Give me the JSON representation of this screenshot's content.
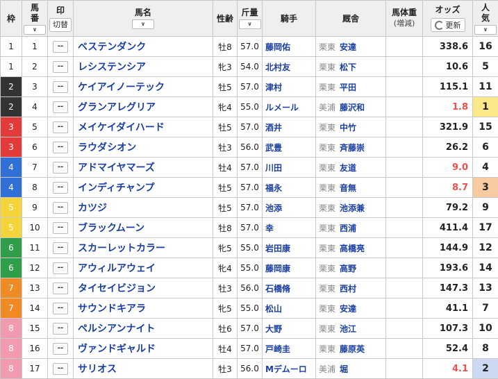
{
  "colors": {
    "waku": {
      "1": {
        "bg": "#ffffff",
        "fg": "#222222"
      },
      "2": {
        "bg": "#333333",
        "fg": "#ffffff"
      },
      "3": {
        "bg": "#e33a3a",
        "fg": "#ffffff"
      },
      "4": {
        "bg": "#2f6fd6",
        "fg": "#ffffff"
      },
      "5": {
        "bg": "#f5d43a",
        "fg": "#ffffff"
      },
      "6": {
        "bg": "#2e9e48",
        "fg": "#ffffff"
      },
      "7": {
        "bg": "#f08a24",
        "fg": "#ffffff"
      },
      "8": {
        "bg": "#f29ab0",
        "fg": "#ffffff"
      }
    },
    "odds_hot": "#e8524f",
    "odds_normal": "#222222",
    "pop": {
      "1": "#fbe98a",
      "2": "#cdd8f2",
      "3": "#f6cba2"
    }
  },
  "header": {
    "waku": "枠",
    "umaban": [
      "馬",
      "番"
    ],
    "mark": "印",
    "mark_switch": "切替",
    "name": "馬名",
    "sexage": "性齢",
    "weight": "斤量",
    "jockey": "騎手",
    "stable": "厩舎",
    "bodyweight": "馬体重",
    "bodyweight_sub": "(増減)",
    "odds": "オッズ",
    "refresh": "更新",
    "pop": [
      "人",
      "気"
    ],
    "sort_icon": "chevron-down-icon"
  },
  "mark_placeholder": "--",
  "rows": [
    {
      "waku": "1",
      "uma": "1",
      "name": "ベステンダンク",
      "sexage": "牡8",
      "weight": "57.0",
      "jockey": "藤岡佑",
      "region": "栗東",
      "trainer": "安達",
      "odds": "338.6",
      "pop": "16",
      "hot": false
    },
    {
      "waku": "1",
      "uma": "2",
      "name": "レシステンシア",
      "sexage": "牝3",
      "weight": "54.0",
      "jockey": "北村友",
      "region": "栗東",
      "trainer": "松下",
      "odds": "10.6",
      "pop": "5",
      "hot": false
    },
    {
      "waku": "2",
      "uma": "3",
      "name": "ケイアイノーテック",
      "sexage": "牡5",
      "weight": "57.0",
      "jockey": "津村",
      "region": "栗東",
      "trainer": "平田",
      "odds": "115.1",
      "pop": "11",
      "hot": false
    },
    {
      "waku": "2",
      "uma": "4",
      "name": "グランアレグリア",
      "sexage": "牝4",
      "weight": "55.0",
      "jockey": "ルメール",
      "region": "美浦",
      "trainer": "藤沢和",
      "odds": "1.8",
      "pop": "1",
      "hot": true
    },
    {
      "waku": "3",
      "uma": "5",
      "name": "メイケイダイハード",
      "sexage": "牡5",
      "weight": "57.0",
      "jockey": "酒井",
      "region": "栗東",
      "trainer": "中竹",
      "odds": "321.9",
      "pop": "15",
      "hot": false
    },
    {
      "waku": "3",
      "uma": "6",
      "name": "ラウダシオン",
      "sexage": "牡3",
      "weight": "56.0",
      "jockey": "武豊",
      "region": "栗東",
      "trainer": "斉藤崇",
      "odds": "26.2",
      "pop": "6",
      "hot": false
    },
    {
      "waku": "4",
      "uma": "7",
      "name": "アドマイヤマーズ",
      "sexage": "牡4",
      "weight": "57.0",
      "jockey": "川田",
      "region": "栗東",
      "trainer": "友道",
      "odds": "9.0",
      "pop": "4",
      "hot": true
    },
    {
      "waku": "4",
      "uma": "8",
      "name": "インディチャンプ",
      "sexage": "牡5",
      "weight": "57.0",
      "jockey": "福永",
      "region": "栗東",
      "trainer": "音無",
      "odds": "8.7",
      "pop": "3",
      "hot": true
    },
    {
      "waku": "5",
      "uma": "9",
      "name": "カツジ",
      "sexage": "牡5",
      "weight": "57.0",
      "jockey": "池添",
      "region": "栗東",
      "trainer": "池添兼",
      "odds": "79.2",
      "pop": "9",
      "hot": false
    },
    {
      "waku": "5",
      "uma": "10",
      "name": "ブラックムーン",
      "sexage": "牡8",
      "weight": "57.0",
      "jockey": "幸",
      "region": "栗東",
      "trainer": "西浦",
      "odds": "411.4",
      "pop": "17",
      "hot": false
    },
    {
      "waku": "6",
      "uma": "11",
      "name": "スカーレットカラー",
      "sexage": "牝5",
      "weight": "55.0",
      "jockey": "岩田康",
      "region": "栗東",
      "trainer": "高橋亮",
      "odds": "144.9",
      "pop": "12",
      "hot": false
    },
    {
      "waku": "6",
      "uma": "12",
      "name": "アウィルアウェイ",
      "sexage": "牝4",
      "weight": "55.0",
      "jockey": "藤岡康",
      "region": "栗東",
      "trainer": "高野",
      "odds": "193.6",
      "pop": "14",
      "hot": false
    },
    {
      "waku": "7",
      "uma": "13",
      "name": "タイセイビジョン",
      "sexage": "牡3",
      "weight": "56.0",
      "jockey": "石橋脩",
      "region": "栗東",
      "trainer": "西村",
      "odds": "147.3",
      "pop": "13",
      "hot": false
    },
    {
      "waku": "7",
      "uma": "14",
      "name": "サウンドキアラ",
      "sexage": "牝5",
      "weight": "55.0",
      "jockey": "松山",
      "region": "栗東",
      "trainer": "安達",
      "odds": "41.1",
      "pop": "7",
      "hot": false
    },
    {
      "waku": "8",
      "uma": "15",
      "name": "ペルシアンナイト",
      "sexage": "牡6",
      "weight": "57.0",
      "jockey": "大野",
      "region": "栗東",
      "trainer": "池江",
      "odds": "107.3",
      "pop": "10",
      "hot": false
    },
    {
      "waku": "8",
      "uma": "16",
      "name": "ヴァンドギャルド",
      "sexage": "牡4",
      "weight": "57.0",
      "jockey": "戸崎圭",
      "region": "栗東",
      "trainer": "藤原英",
      "odds": "52.4",
      "pop": "8",
      "hot": false
    },
    {
      "waku": "8",
      "uma": "17",
      "name": "サリオス",
      "sexage": "牡3",
      "weight": "56.0",
      "jockey": "Mデムーロ",
      "region": "美浦",
      "trainer": "堀",
      "odds": "4.1",
      "pop": "2",
      "hot": true
    }
  ]
}
